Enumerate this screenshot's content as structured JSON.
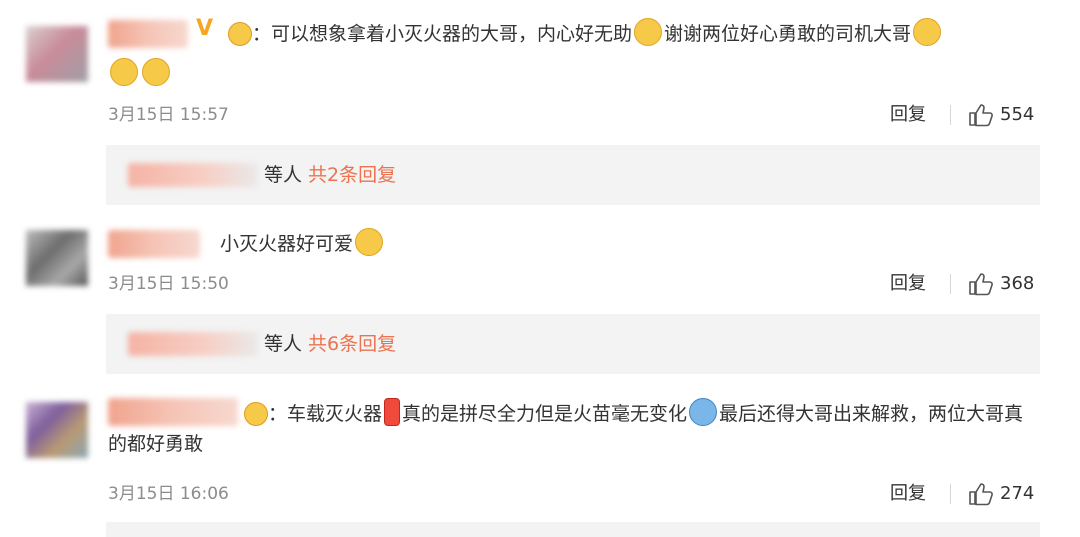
{
  "comments": [
    {
      "text_main": "：可以想象拿着小灭火器的大哥，内心好无助",
      "text_after1": "谢谢两位好心勇敢的司机大哥",
      "time": "3月15日 15:57",
      "reply": "回复",
      "likes": "554",
      "sub_suffix": "等人",
      "sub_link": "共2条回复"
    },
    {
      "text_main": "小灭火器好可爱",
      "time": "3月15日 15:50",
      "reply": "回复",
      "likes": "368",
      "sub_suffix": "等人",
      "sub_link": "共6条回复"
    },
    {
      "text_main": "：车载灭火器",
      "text_mid": "真的是拼尽全力但是火苗毫无变化",
      "text_after": "最后还得大哥出来解救，两位大哥真的都好勇敢",
      "time": "3月15日 16:06",
      "reply": "回复",
      "likes": "274"
    }
  ],
  "verified_mark": "V",
  "colors": {
    "accent": "#eb7350",
    "muted": "#8c8c8c",
    "subbar": "#f3f3f3"
  },
  "icons": [
    "thumbs-up-icon",
    "emoji-icon",
    "verified-icon",
    "fire-extinguisher-emoji"
  ]
}
